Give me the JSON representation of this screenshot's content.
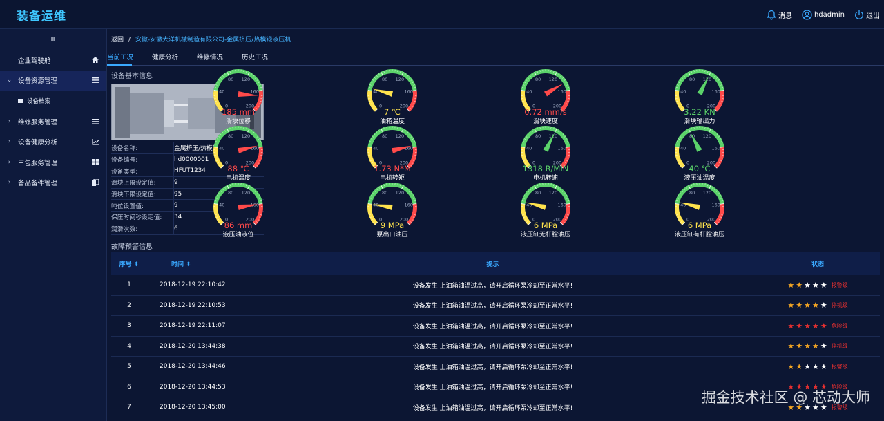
{
  "app": {
    "title": "装备运维"
  },
  "header": {
    "messages": "消息",
    "user": "hdadmin",
    "logout": "退出"
  },
  "sidebar": {
    "collapse_icon": "Ⅲ",
    "items": [
      {
        "label": "企业驾驶舱",
        "icon": "home-icon"
      },
      {
        "label": "设备资源管理",
        "icon": "list-icon",
        "expanded": true
      },
      {
        "label": "设备档案",
        "icon": "square-icon",
        "sub": true
      },
      {
        "label": "维修服务管理",
        "icon": "list-icon"
      },
      {
        "label": "设备健康分析",
        "icon": "chart-icon"
      },
      {
        "label": "三包服务管理",
        "icon": "grid-icon"
      },
      {
        "label": "备品备件管理",
        "icon": "doc-icon"
      }
    ]
  },
  "breadcrumb": {
    "back": "返回",
    "sep": "/",
    "path": "安徽-安徽大洋机械制造有限公司-金属挤压/热模锻液压机"
  },
  "tabs": [
    "当前工况",
    "健康分析",
    "维修情况",
    "历史工况"
  ],
  "basic_info": {
    "title": "设备基本信息",
    "rows": [
      {
        "k": "设备名称:",
        "v": "金属挤压/热模锻液压机"
      },
      {
        "k": "设备编号:",
        "v": "hd0000001"
      },
      {
        "k": "设备类型:",
        "v": "HFUT1234"
      },
      {
        "k": "滑块上限设定值:",
        "v": "9"
      },
      {
        "k": "滑块下限设定值:",
        "v": "95"
      },
      {
        "k": "吨位设置值:",
        "v": "9"
      },
      {
        "k": "保压时间秒设定值:",
        "v": "34"
      },
      {
        "k": "润滑次数:",
        "v": "6"
      }
    ]
  },
  "gauges": [
    {
      "label": "滑块位移",
      "value": "185 mm",
      "color": "#ff4a4a",
      "frac": 0.85
    },
    {
      "label": "油箱温度",
      "value": "7 ℃",
      "color": "#ffe34d",
      "frac": 0.22
    },
    {
      "label": "滑块速度",
      "value": "0.72 mm/s",
      "color": "#ff4a4a",
      "frac": 0.72
    },
    {
      "label": "滑块输出力",
      "value": "3.22 KN",
      "color": "#5bd36a",
      "frac": 0.6
    },
    {
      "label": "电机温度",
      "value": "88 ℃",
      "color": "#ff4a4a",
      "frac": 0.78
    },
    {
      "label": "电机转矩",
      "value": "1.73 N*M",
      "color": "#ff4a4a",
      "frac": 0.78
    },
    {
      "label": "电机转速",
      "value": "1318 R/MIN",
      "color": "#5bd36a",
      "frac": 0.6
    },
    {
      "label": "液压油温度",
      "value": "40 ℃",
      "color": "#5bd36a",
      "frac": 0.4
    },
    {
      "label": "液压油液位",
      "value": "86 mm",
      "color": "#ff4a4a",
      "frac": 0.8
    },
    {
      "label": "泵出口油压",
      "value": "9 MPa",
      "color": "#ffe34d",
      "frac": 0.2
    },
    {
      "label": "液压缸无杆腔油压",
      "value": "6 MPa",
      "color": "#ffe34d",
      "frac": 0.22
    },
    {
      "label": "液压缸有杆腔油压",
      "value": "6 MPa",
      "color": "#ffe34d",
      "frac": 0.22
    }
  ],
  "gauge_ticks": [
    "0",
    "40",
    "80",
    "120",
    "160",
    "200"
  ],
  "alarm": {
    "title": "故障预警信息",
    "headers": [
      "序号",
      "时间",
      "提示",
      "状态"
    ],
    "sort_icon": "⬍",
    "rows": [
      {
        "no": "1",
        "time": "2018-12-19 22:10:42",
        "msg": "设备发生 上油箱油温过高，请开启循环泵冷却至正常水平!",
        "stars": 2,
        "star_color": "#f5a623",
        "level": "报警级"
      },
      {
        "no": "2",
        "time": "2018-12-19 22:10:53",
        "msg": "设备发生 上油箱油温过高，请开启循环泵冷却至正常水平!",
        "stars": 4,
        "star_color": "#f5a623",
        "level": "停机级"
      },
      {
        "no": "3",
        "time": "2018-12-19 22:11:07",
        "msg": "设备发生 上油箱油温过高，请开启循环泵冷却至正常水平!",
        "stars": 5,
        "star_color": "#e83030",
        "level": "危险级"
      },
      {
        "no": "4",
        "time": "2018-12-20 13:44:38",
        "msg": "设备发生 上油箱油温过高，请开启循环泵冷却至正常水平!",
        "stars": 4,
        "star_color": "#f5a623",
        "level": "停机级"
      },
      {
        "no": "5",
        "time": "2018-12-20 13:44:46",
        "msg": "设备发生 上油箱油温过高，请开启循环泵冷却至正常水平!",
        "stars": 2,
        "star_color": "#f5a623",
        "level": "报警级"
      },
      {
        "no": "6",
        "time": "2018-12-20 13:44:53",
        "msg": "设备发生 上油箱油温过高，请开启循环泵冷却至正常水平!",
        "stars": 5,
        "star_color": "#e83030",
        "level": "危险级"
      },
      {
        "no": "7",
        "time": "2018-12-20 13:45:00",
        "msg": "设备发生 上油箱油温过高，请开启循环泵冷却至正常水平!",
        "stars": 2,
        "star_color": "#f5a623",
        "level": "报警级"
      }
    ]
  },
  "watermark": "掘金技术社区 @ 芯动大师"
}
